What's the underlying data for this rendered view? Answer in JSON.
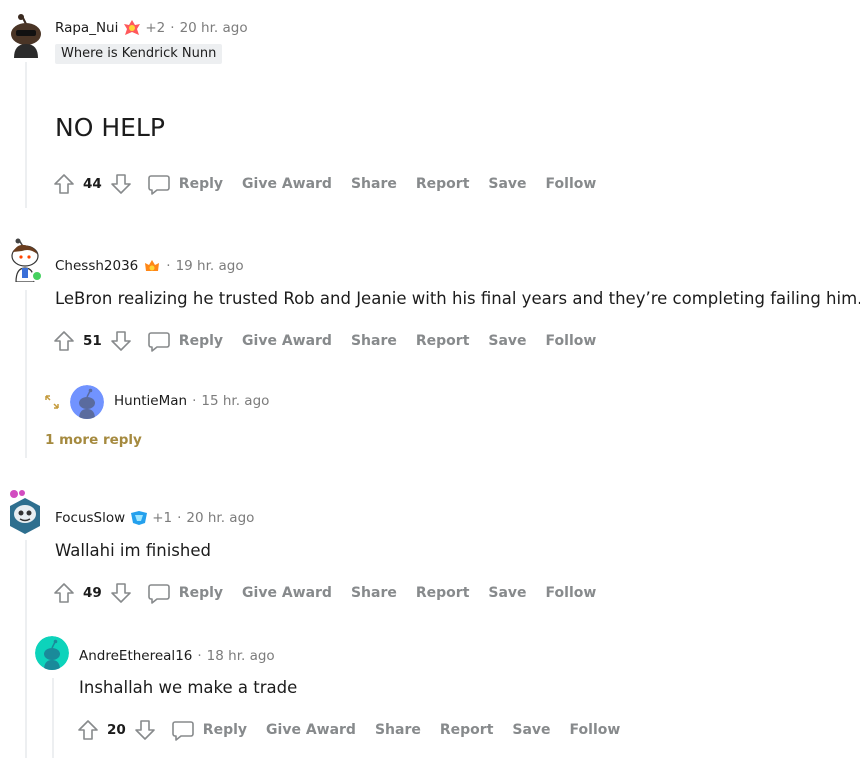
{
  "comments": [
    {
      "author": "Rapa_Nui",
      "award_extra": "+2",
      "time": "20 hr. ago",
      "user_flair": "Where is Kendrick Nunn",
      "body": "NO HELP",
      "score": "44"
    },
    {
      "author": "Chessh2036",
      "time": "19 hr. ago",
      "body": "LeBron realizing he trusted Rob and Jeanie with his final years and they’re completing failing him.",
      "score": "51",
      "collapsed_reply": {
        "author": "HuntieMan",
        "time": "15 hr. ago"
      },
      "more_replies": "1 more reply"
    },
    {
      "author": "FocusSlow",
      "award_extra": "+1",
      "time": "20 hr. ago",
      "body": "Wallahi im finished",
      "score": "49"
    },
    {
      "author": "AndreEthereal16",
      "time": "18 hr. ago",
      "body": "Inshallah we make a trade",
      "score": "20"
    }
  ],
  "actions": {
    "reply": "Reply",
    "give_award": "Give Award",
    "share": "Share",
    "report": "Report",
    "save": "Save",
    "follow": "Follow"
  },
  "separator": "·",
  "icons": {
    "upvote": "upvote-arrow-icon",
    "downvote": "downvote-arrow-icon",
    "reply": "speech-bubble-icon",
    "expand": "expand-arrows-icon"
  },
  "colors": {
    "text": "#1c1c1c",
    "meta": "#7c7c7c",
    "action": "#878a8c",
    "more_reply": "#a58a3f",
    "flair_bg": "#edeff1",
    "online": "#46d160"
  }
}
